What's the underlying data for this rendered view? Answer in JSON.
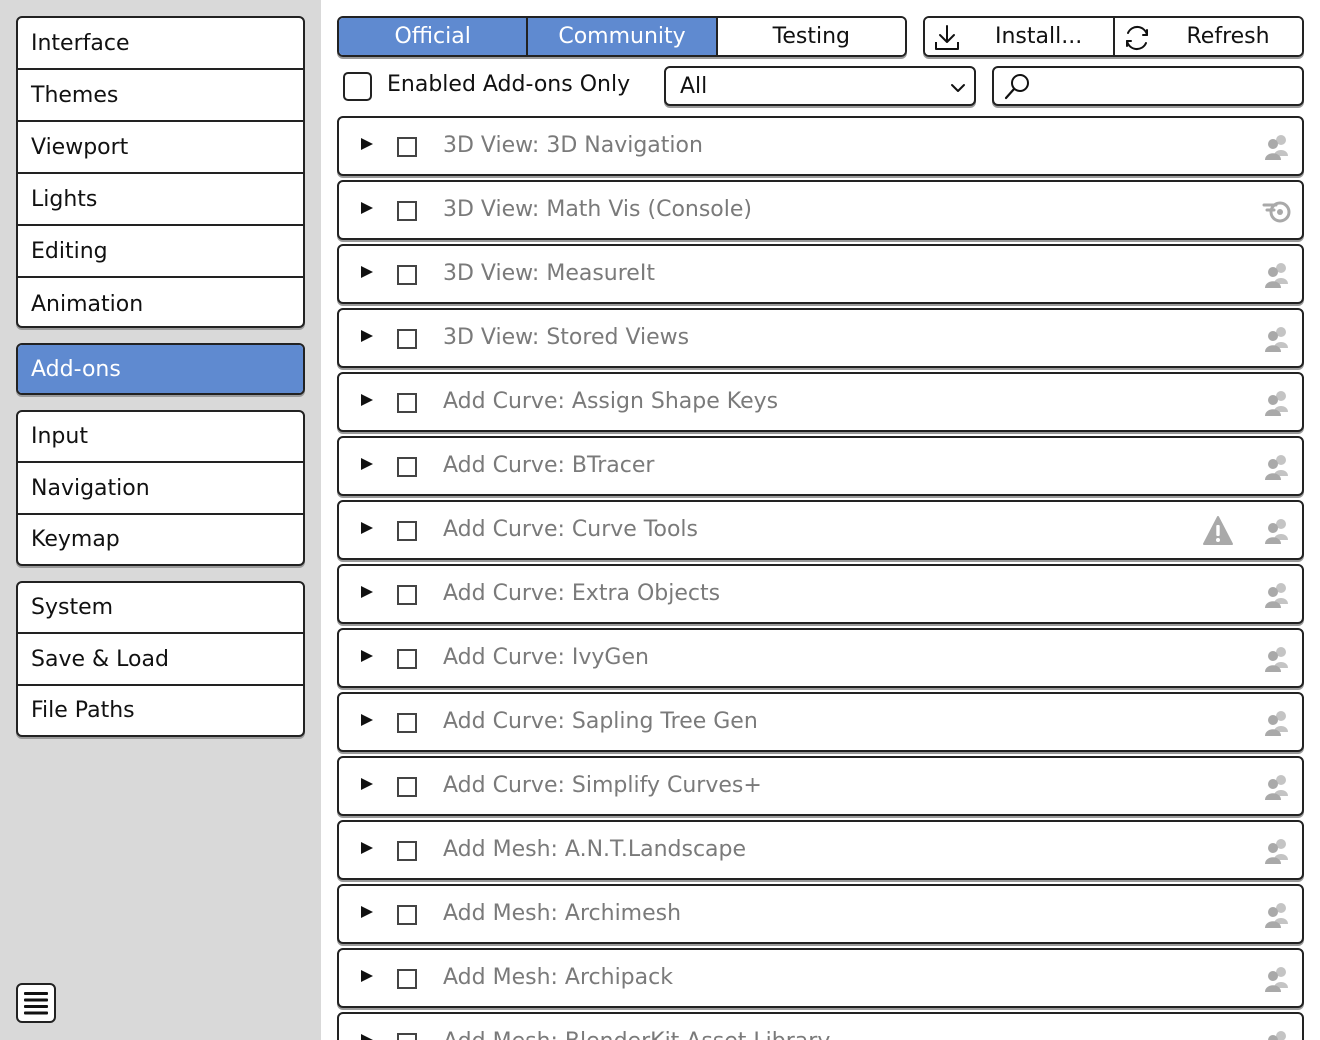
{
  "sidebar": {
    "group1": [
      {
        "id": "interface",
        "label": "Interface"
      },
      {
        "id": "themes",
        "label": "Themes"
      },
      {
        "id": "viewport",
        "label": "Viewport"
      },
      {
        "id": "lights",
        "label": "Lights"
      },
      {
        "id": "editing",
        "label": "Editing"
      },
      {
        "id": "animation",
        "label": "Animation"
      }
    ],
    "group2": [
      {
        "id": "addons",
        "label": "Add-ons",
        "active": true
      }
    ],
    "group3": [
      {
        "id": "input",
        "label": "Input"
      },
      {
        "id": "navigation",
        "label": "Navigation"
      },
      {
        "id": "keymap",
        "label": "Keymap"
      }
    ],
    "group4": [
      {
        "id": "system",
        "label": "System"
      },
      {
        "id": "save-load",
        "label": "Save & Load"
      },
      {
        "id": "file-paths",
        "label": "File Paths"
      }
    ],
    "menu_icon": "hamburger-menu-icon"
  },
  "tabs": [
    {
      "id": "official",
      "label": "Official",
      "active": true
    },
    {
      "id": "community",
      "label": "Community",
      "active": true
    },
    {
      "id": "testing",
      "label": "Testing",
      "active": false
    }
  ],
  "actions": {
    "install_label": "Install...",
    "install_icon": "download-icon",
    "refresh_label": "Refresh",
    "refresh_icon": "refresh-icon"
  },
  "filter": {
    "enabled_only_label": "Enabled Add-ons Only",
    "enabled_only_checked": false,
    "category_value": "All",
    "search_value": "",
    "search_placeholder": ""
  },
  "addons": [
    {
      "name": "3D View: 3D Navigation",
      "support": "community",
      "warning": false,
      "enabled": false
    },
    {
      "name": "3D View: Math Vis (Console)",
      "support": "official",
      "warning": false,
      "enabled": false
    },
    {
      "name": "3D View: MeasureIt",
      "support": "community",
      "warning": false,
      "enabled": false
    },
    {
      "name": "3D View: Stored Views",
      "support": "community",
      "warning": false,
      "enabled": false
    },
    {
      "name": "Add Curve: Assign Shape Keys",
      "support": "community",
      "warning": false,
      "enabled": false
    },
    {
      "name": "Add Curve: BTracer",
      "support": "community",
      "warning": false,
      "enabled": false
    },
    {
      "name": "Add Curve: Curve Tools",
      "support": "community",
      "warning": true,
      "enabled": false
    },
    {
      "name": "Add Curve: Extra Objects",
      "support": "community",
      "warning": false,
      "enabled": false
    },
    {
      "name": "Add Curve: IvyGen",
      "support": "community",
      "warning": false,
      "enabled": false
    },
    {
      "name": "Add Curve: Sapling Tree Gen",
      "support": "community",
      "warning": false,
      "enabled": false
    },
    {
      "name": "Add Curve: Simplify Curves+",
      "support": "community",
      "warning": false,
      "enabled": false
    },
    {
      "name": "Add Mesh: A.N.T.Landscape",
      "support": "community",
      "warning": false,
      "enabled": false
    },
    {
      "name": "Add Mesh: Archimesh",
      "support": "community",
      "warning": false,
      "enabled": false
    },
    {
      "name": "Add Mesh: Archipack",
      "support": "community",
      "warning": false,
      "enabled": false
    },
    {
      "name": "Add Mesh: BlenderKit Asset Library",
      "support": "community",
      "warning": false,
      "enabled": false
    }
  ],
  "colors": {
    "accent": "#5f8ad0",
    "sidebar_bg": "#d9d9d9",
    "addon_text": "#7a7a7a"
  }
}
